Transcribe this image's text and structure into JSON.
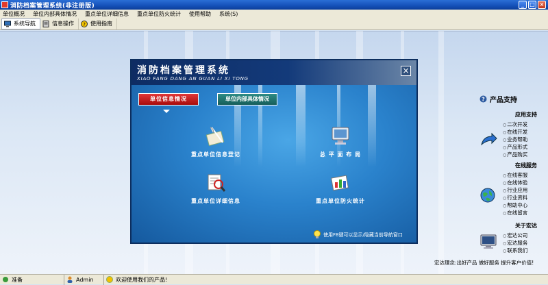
{
  "window": {
    "title": "消防档案管理系统(非注册版)"
  },
  "menu": [
    "单位概况",
    "单位内部具体情况",
    "重点单位详细信息",
    "重点单位防火统计",
    "使用帮助",
    "系统(S)"
  ],
  "toolbar": {
    "nav": "系统导航",
    "ops": "信息操作",
    "guide": "使用指南"
  },
  "dialog": {
    "title": "消防档案管理系统",
    "subtitle": "XIAO FANG DANG AN GUAN LI XI TONG",
    "tab_active": "单位信息情况",
    "tab_other": "单位内部具体情况",
    "items": {
      "register": "重点单位信息登记",
      "layout": "总 平 面 布 局",
      "detail": "重点单位详细信息",
      "stats": "重点单位防火统计"
    },
    "hint": "使用F8键可以显示/隐藏当前导航窗口"
  },
  "right_panel": {
    "title": "产品支持",
    "sections": [
      {
        "heading": "应用支持",
        "items": [
          "二次开发",
          "在线开发",
          "业务帮助",
          "产品形式",
          "产品购买"
        ]
      },
      {
        "heading": "在线服务",
        "items": [
          "在线客服",
          "在线体验",
          "行业应用",
          "行业资料",
          "帮助中心",
          "在线留言"
        ]
      },
      {
        "heading": "关于宏达",
        "items": [
          "宏达公司",
          "宏达服务",
          "联系我们"
        ]
      }
    ],
    "slogan": "宏达理念:出好产品 做好服务 提升客户价值!"
  },
  "status": {
    "ready": "准备",
    "user": "Admin",
    "welcome": "欢迎使用我们的产品!"
  },
  "colors": {
    "accent_red": "#c41b1b",
    "dialog_blue": "#1565a8",
    "title_blue": "#1450b8"
  }
}
